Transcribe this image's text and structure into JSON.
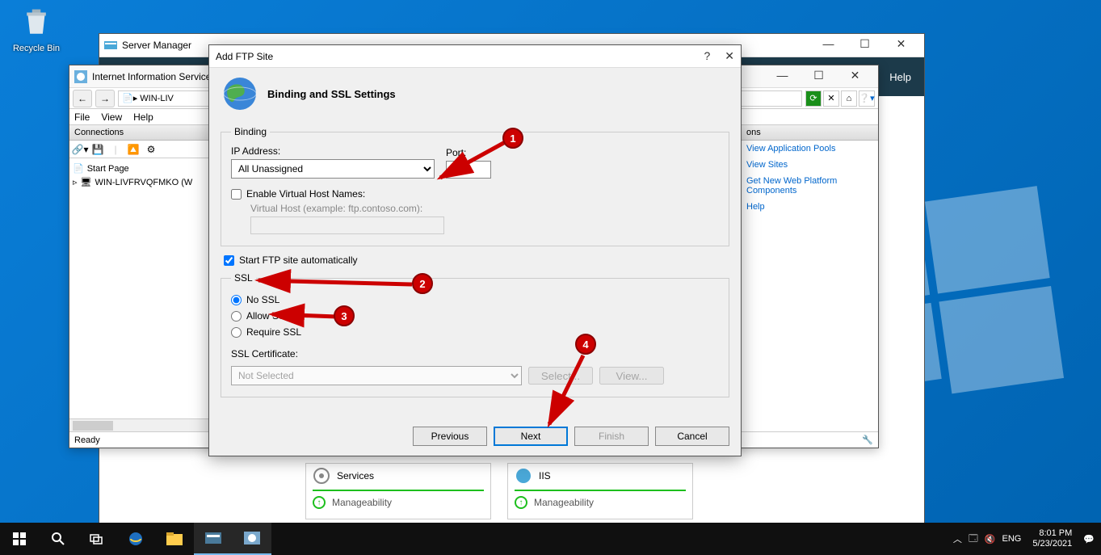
{
  "desktop": {
    "recycle_bin": "Recycle Bin"
  },
  "server_manager": {
    "title": "Server Manager",
    "menus": {
      "help": "Help"
    },
    "tiles": {
      "services": {
        "label": "Services",
        "manage": "Manageability"
      },
      "iis": {
        "label": "IIS",
        "manage": "Manageability"
      }
    }
  },
  "iis": {
    "title": "Internet Information Services",
    "breadcrumb": "▸ WIN-LIV",
    "menus": {
      "file": "File",
      "view": "View",
      "help": "Help"
    },
    "panel_connections": "Connections",
    "tree": {
      "start_page": "Start Page",
      "server": "WIN-LIVFRVQFMKO (W"
    },
    "panel_actions_title": "ons",
    "actions": {
      "app_pools": "View Application Pools",
      "sites": "View Sites",
      "new_platform": "Get New Web Platform Components",
      "help": "Help"
    },
    "status": "Ready"
  },
  "ftp": {
    "title": "Add FTP Site",
    "heading": "Binding and SSL Settings",
    "binding": {
      "legend": "Binding",
      "ip_label": "IP Address:",
      "ip_value": "All Unassigned",
      "port_label": "Port:",
      "port_value": "21",
      "vhost_check": "Enable Virtual Host Names:",
      "vhost_hint": "Virtual Host (example: ftp.contoso.com):"
    },
    "auto_start": "Start FTP site automatically",
    "ssl": {
      "legend": "SSL",
      "no": "No SSL",
      "allow": "Allow SSL",
      "require": "Require SSL",
      "cert_label": "SSL Certificate:",
      "cert_value": "Not Selected",
      "select": "Select...",
      "view": "View..."
    },
    "buttons": {
      "prev": "Previous",
      "next": "Next",
      "finish": "Finish",
      "cancel": "Cancel"
    }
  },
  "callouts": {
    "c1": "1",
    "c2": "2",
    "c3": "3",
    "c4": "4"
  },
  "tray": {
    "lang": "ENG",
    "time": "8:01 PM",
    "date": "5/23/2021"
  }
}
